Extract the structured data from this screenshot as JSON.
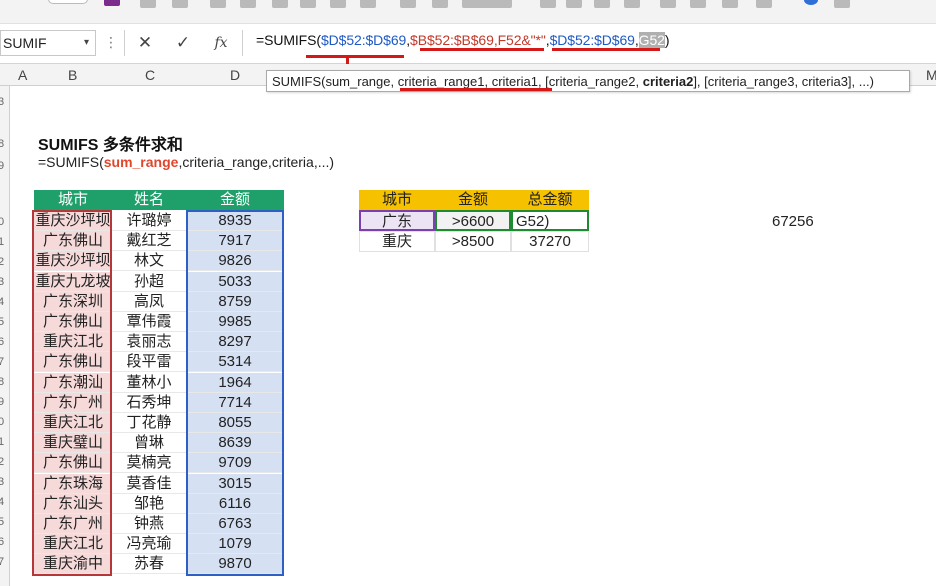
{
  "formula_bar": {
    "name_box": "SUMIF",
    "name_box_caret": "▾",
    "more_icon": "⋮",
    "cancel_icon": "✕",
    "enter_icon": "✓",
    "fx_label": "fx",
    "formula_prefix": "=SUMIFS(",
    "arg1": "$D$52:$D$69",
    "sep1": ",",
    "arg2": "$B$52:$B$69",
    "arg2b": ",F52&\"*\"",
    "sep2": ",",
    "arg3": "$D$52:$D$69",
    "sep3": ",",
    "arg4": "G52",
    "formula_suffix": ")"
  },
  "column_headers": [
    "A",
    "B",
    "C",
    "D",
    "M"
  ],
  "row_numbers": [
    "3",
    "",
    "",
    "",
    "",
    "",
    "",
    "8",
    "",
    "9",
    "0",
    "1",
    "2",
    "3",
    "4",
    "5",
    "6",
    "7",
    "8",
    "9",
    "0",
    "1",
    "2",
    "3",
    "4",
    "5",
    "6",
    "7",
    "8",
    "9"
  ],
  "tooltip": {
    "text_start": "SUMIFS(",
    "p1": "sum_range",
    "sep1": ", ",
    "p2": "criteria_range1",
    "sep2": ", ",
    "p3": "criteria1",
    "sep3": ", [criteria_range2, ",
    "p4": "criteria2",
    "rest": "], [criteria_range3, criteria3], ...)"
  },
  "heading": "SUMIFS 多条件求和",
  "syntax": {
    "prefix": "=SUMIFS(",
    "highlight": "sum_range",
    "rest": ",criteria_range,criteria,...)"
  },
  "source_table": {
    "headers": [
      "城市",
      "姓名",
      "金额"
    ],
    "rows": [
      [
        "重庆沙坪坝",
        "许璐婷",
        "8935"
      ],
      [
        "广东佛山",
        "戴红芝",
        "7917"
      ],
      [
        "重庆沙坪坝",
        "林文",
        "9826"
      ],
      [
        "重庆九龙坡",
        "孙超",
        "5033"
      ],
      [
        "广东深圳",
        "高凤",
        "8759"
      ],
      [
        "广东佛山",
        "覃伟霞",
        "9985"
      ],
      [
        "重庆江北",
        "袁丽志",
        "8297"
      ],
      [
        "广东佛山",
        "段平雷",
        "5314"
      ],
      [
        "广东潮汕",
        "董林小",
        "1964"
      ],
      [
        "广东广州",
        "石秀坤",
        "7714"
      ],
      [
        "重庆江北",
        "丁花静",
        "8055"
      ],
      [
        "重庆璧山",
        "曾琳",
        "8639"
      ],
      [
        "广东佛山",
        "莫楠亮",
        "9709"
      ],
      [
        "广东珠海",
        "莫香佳",
        "3015"
      ],
      [
        "广东汕头",
        "邹艳",
        "6116"
      ],
      [
        "广东广州",
        "钟燕",
        "6763"
      ],
      [
        "重庆江北",
        "冯亮瑜",
        "1079"
      ],
      [
        "重庆渝中",
        "苏春",
        "9870"
      ]
    ]
  },
  "criteria_table": {
    "headers": [
      "城市",
      "金额",
      "总金额"
    ],
    "rows": [
      [
        "广东",
        ">6600",
        "G52)"
      ],
      [
        "重庆",
        ">8500",
        "37270"
      ]
    ]
  },
  "result_value": "67256",
  "colors": {
    "source_header": "#1fa06a",
    "criteria_header": "#f6c200",
    "sum_range_highlight": "#e0462b",
    "range_blue": "#2e5fc4",
    "range_red": "#b6373a",
    "criteria_green": "#1f8a32",
    "criteria_purple": "#7a3fb0"
  }
}
